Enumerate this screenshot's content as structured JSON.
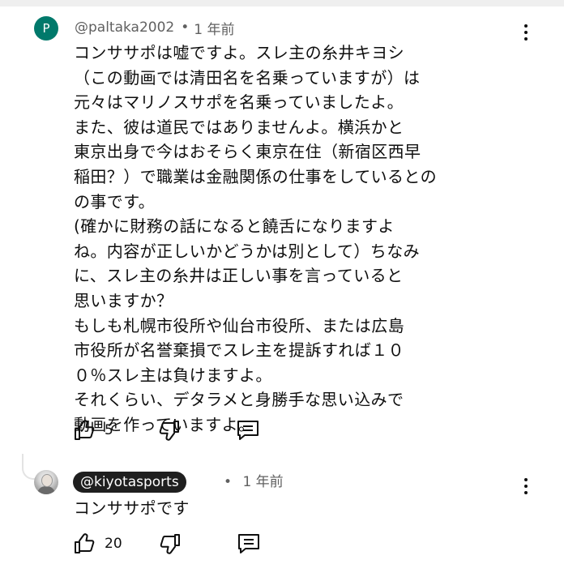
{
  "comment": {
    "avatar_letter": "P",
    "handle": "@paltaka2002",
    "separator": "•",
    "time": "1 年前",
    "lines": [
      "コンササポは嘘ですよ。スレ主の糸井キヨシ",
      "（この動画では清田名を名乗っていますが）は",
      "元々はマリノスサポを名乗っていましたよ。",
      "また、彼は道民ではありませんよ。横浜かと",
      "東京出身で今はおそらく東京在住（新宿区西早",
      "稲田？）で職業は金融関係の仕事をしているとの",
      "の事です。",
      "(確かに財務の話になると饒舌になりますよ",
      "ね。内容が正しいかどうかは別として）ちなみ",
      "に、スレ主の糸井は正しい事を言っていると",
      "思いますか？",
      "もしも札幌市役所や仙台市役所、または広島",
      "市役所が名誉棄損でスレ主を提訴すれば１０",
      "０％スレ主は負けますよ。",
      "それくらい、デタラメと身勝手な思い込みで",
      "動画を作っていますよ。"
    ],
    "likes": "5"
  },
  "reply": {
    "handle": "@kiyotasports",
    "separator": "•",
    "time": "1 年前",
    "text": "コンササポです",
    "likes": "20"
  },
  "icons": {
    "like": "thumbs-up-icon",
    "dislike": "thumbs-down-icon",
    "reply": "comment-icon",
    "menu": "more-vert-icon"
  }
}
